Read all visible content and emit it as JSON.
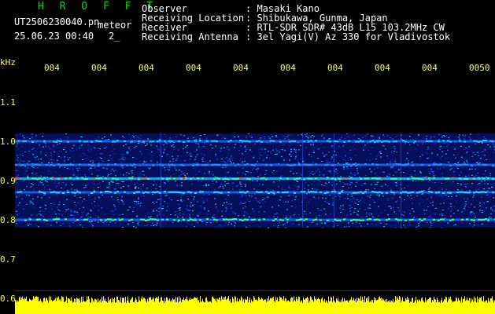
{
  "header": {
    "brand": "H R O F F T",
    "filename": "UT2506230040.pn",
    "filename_suffix": "meteor",
    "datetime": "25.06.23 00:40",
    "extra": "2_",
    "fields": [
      {
        "label": "Observer",
        "value": ": Masaki Kano"
      },
      {
        "label": "Receiving Location",
        "value": ": Shibukawa, Gunma, Japan"
      },
      {
        "label": "Receiver",
        "value": ": RTL-SDR SDR# 43dB L15 103.2MHz CW"
      },
      {
        "label": "Receiving Antenna",
        "value": ": 3el Yagi(V) Az 330 for Vladivostok"
      }
    ]
  },
  "chart_data": {
    "type": "heatmap",
    "ylabel": "kHz",
    "y_ticks": [
      "1.1",
      "1.0",
      "0.9",
      "0.8",
      "0.7",
      "0.6"
    ],
    "x_ticks": [
      "004",
      "004",
      "004",
      "004",
      "004",
      "004",
      "004",
      "004",
      "004",
      "0050"
    ],
    "ylim": [
      0.6,
      1.1
    ],
    "band_range": [
      0.78,
      1.02
    ],
    "bright_lines": [
      0.905,
      0.87,
      0.8,
      1.0,
      0.94
    ]
  },
  "colors": {
    "background": "#000000",
    "header_text": "#ffffff",
    "brand": "#00e000",
    "axis_labels": "#ffff33",
    "noise_low": "#0a1a8c",
    "noise_high": "#ff3030",
    "strip": "#ffff00"
  }
}
